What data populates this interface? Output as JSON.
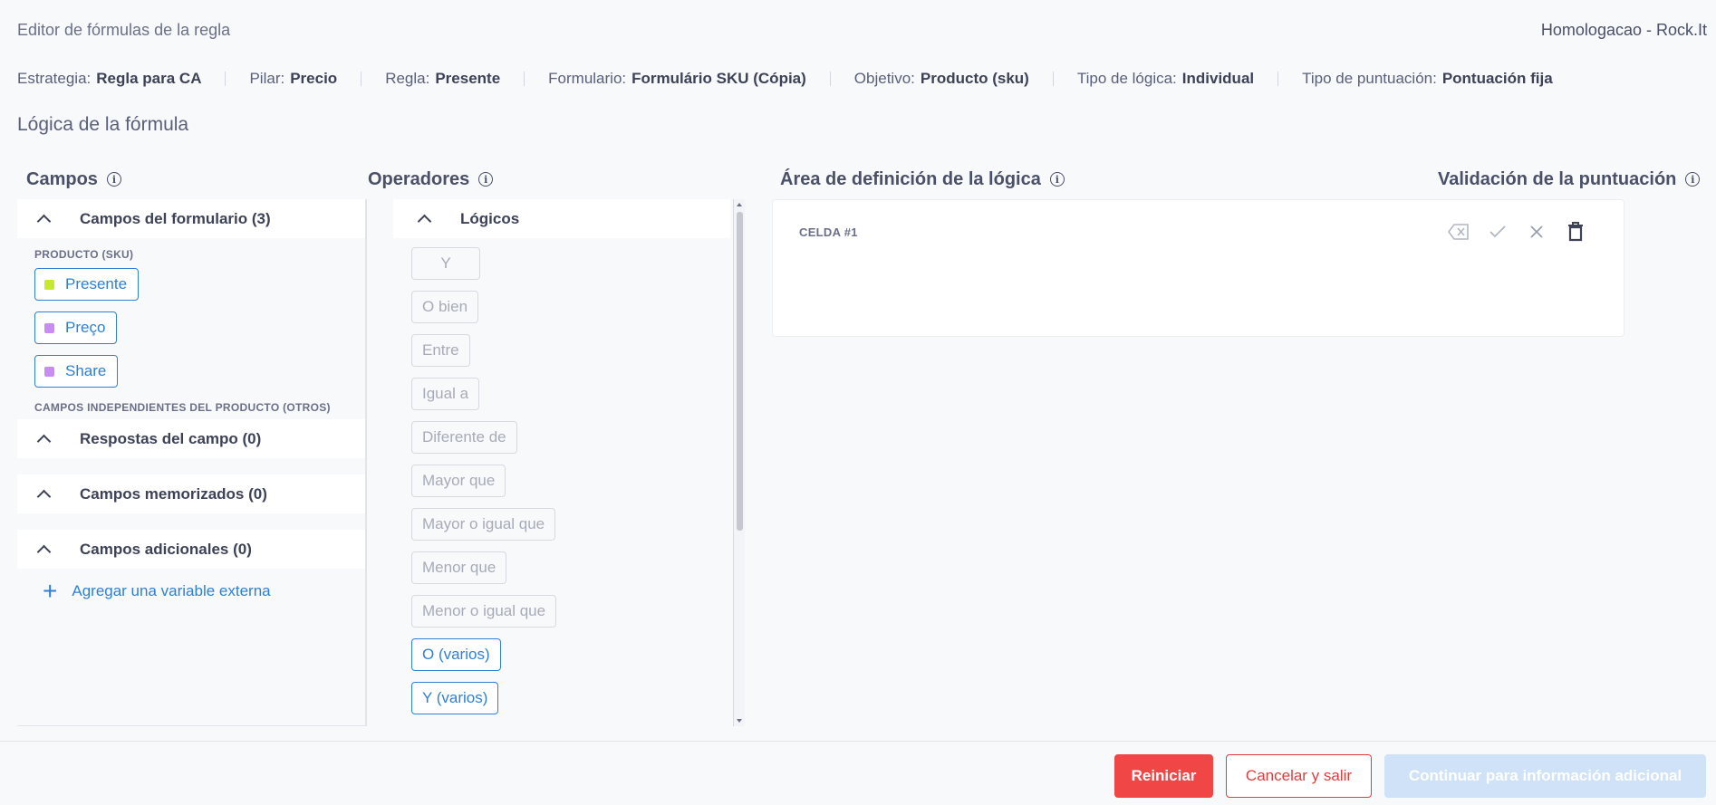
{
  "header": {
    "title": "Editor de fórmulas de la regla",
    "org": "Homologacao - Rock.It"
  },
  "meta": [
    {
      "key": "Estrategia:",
      "value": "Regla para CA"
    },
    {
      "key": "Pilar:",
      "value": "Precio"
    },
    {
      "key": "Regla:",
      "value": "Presente"
    },
    {
      "key": "Formulario:",
      "value": "Formulário SKU (Cópia)"
    },
    {
      "key": "Objetivo:",
      "value": "Producto (sku)"
    },
    {
      "key": "Tipo de lógica:",
      "value": "Individual"
    },
    {
      "key": "Tipo de puntuación:",
      "value": "Pontuación fija"
    }
  ],
  "section_title": "Lógica de la fórmula",
  "columns": {
    "fields": "Campos",
    "operators": "Operadores",
    "logic_area": "Área de definición de la lógica",
    "score_validation": "Validación de la puntuación"
  },
  "fields": {
    "form_fields_header": "Campos del formulario (3)",
    "product_caption": "PRODUCTO (SKU)",
    "chips": [
      {
        "label": "Presente",
        "color": "#c6e82e"
      },
      {
        "label": "Preço",
        "color": "#c98cf0"
      },
      {
        "label": "Share",
        "color": "#c98cf0"
      }
    ],
    "independent_caption": "CAMPOS INDEPENDIENTES DEL PRODUCTO (OTROS)",
    "field_answers_header": "Respostas del campo (0)",
    "memorized_header": "Campos memorizados (0)",
    "additional_header": "Campos adicionales (0)",
    "add_external": "Agregar una variable externa"
  },
  "operators": {
    "logical_header": "Lógicos",
    "items": [
      {
        "label": "Y",
        "active": false
      },
      {
        "label": "O bien",
        "active": false
      },
      {
        "label": "Entre",
        "active": false
      },
      {
        "label": "Igual a",
        "active": false
      },
      {
        "label": "Diferente de",
        "active": false
      },
      {
        "label": "Mayor que",
        "active": false
      },
      {
        "label": "Mayor o igual que",
        "active": false
      },
      {
        "label": "Menor que",
        "active": false
      },
      {
        "label": "Menor o igual que",
        "active": false
      },
      {
        "label": "O (varios)",
        "active": true
      },
      {
        "label": "Y (varios)",
        "active": true
      }
    ]
  },
  "cell": {
    "label": "CELDA #1",
    "actions": [
      "backspace-icon",
      "check-icon",
      "close-icon",
      "trash-icon"
    ]
  },
  "footer": {
    "reset": "Reiniciar",
    "cancel": "Cancelar y salir",
    "continue": "Continuar para información adicional"
  }
}
